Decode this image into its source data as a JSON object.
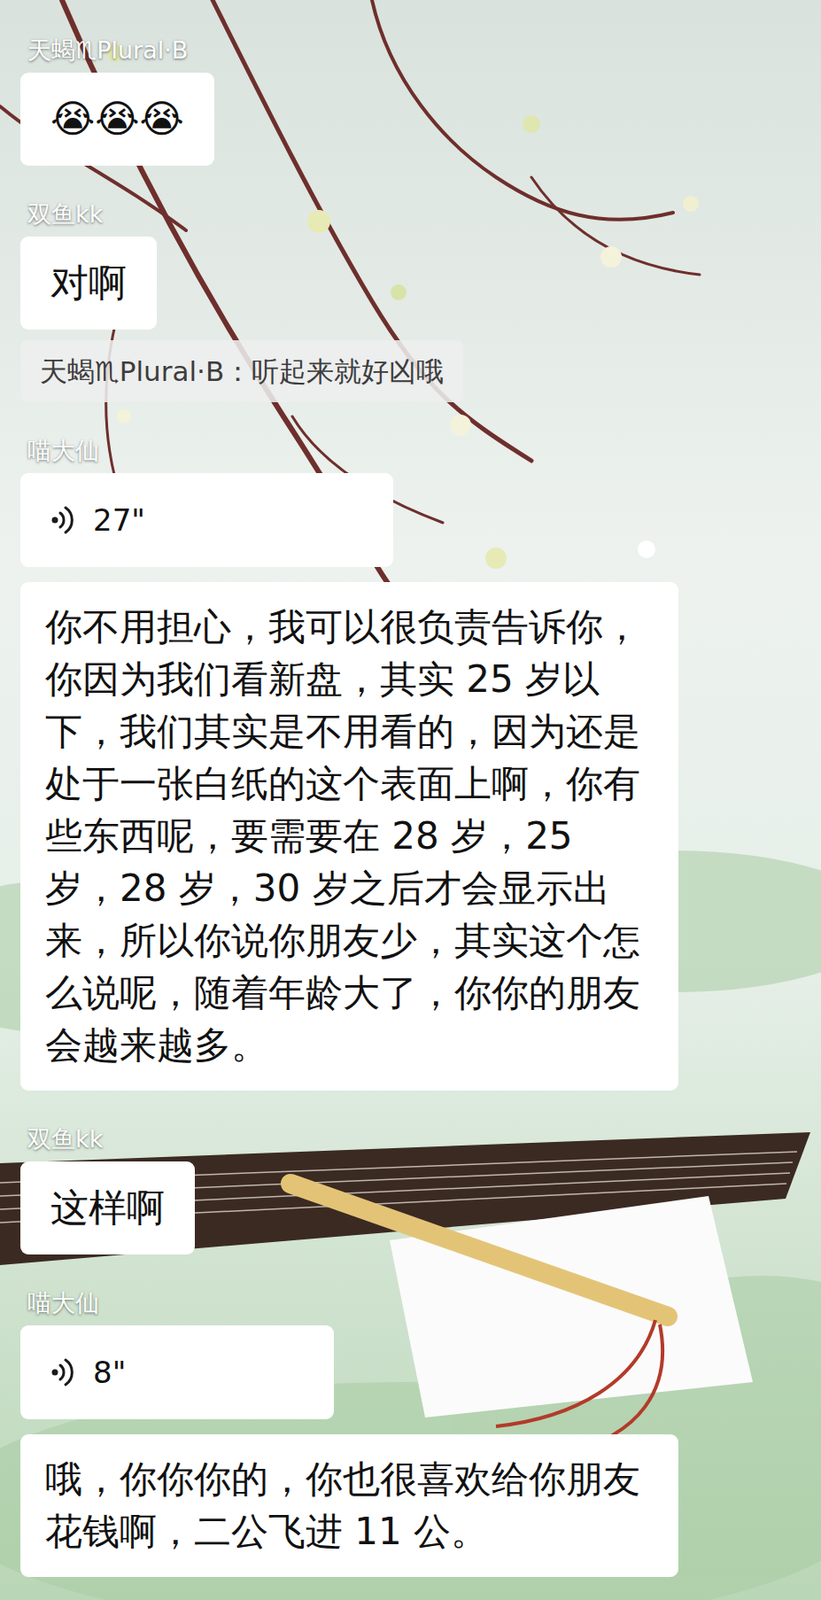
{
  "chat": {
    "messages": [
      {
        "sender": "天蝎♏Plural·B",
        "kind": "text",
        "text": "😭😭😭"
      },
      {
        "sender": "双鱼kk",
        "kind": "text",
        "text": "对啊",
        "quote": "天蝎♏Plural·B：听起来就好凶哦"
      },
      {
        "sender": "喵大仙",
        "kind": "voice",
        "duration": "27\"",
        "transcript": "你不用担心，我可以很负责告诉你，你因为我们看新盘，其实 25 岁以下，我们其实是不用看的，因为还是处于一张白纸的这个表面上啊，你有些东西呢，要需要在 28 岁，25 岁，28 岁，30 岁之后才会显示出来，所以你说你朋友少，其实这个怎么说呢，随着年龄大了，你你的朋友会越来越多。"
      },
      {
        "sender": "双鱼kk",
        "kind": "text",
        "text": "这样啊"
      },
      {
        "sender": "喵大仙",
        "kind": "voice",
        "duration": "8\"",
        "transcript": "哦，你你你的，你也很喜欢给你朋友花钱啊，二公飞进 11 公。"
      }
    ]
  }
}
